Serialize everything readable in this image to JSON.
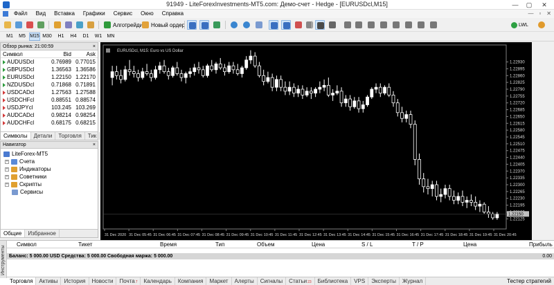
{
  "window": {
    "title": "91949 - LiteForexInvestments-MT5.com: Демо-счет - Hedge - [EURUSDcl,M15]",
    "minimize": "—",
    "maximize": "▢",
    "close": "✕"
  },
  "menu": {
    "items": [
      "Файл",
      "Вид",
      "Вставка",
      "Графики",
      "Сервис",
      "Окно",
      "Справка"
    ],
    "mdi_buttons": [
      "—",
      "▫",
      "✕"
    ]
  },
  "toolbar": {
    "algotrading_label": "Алготрейдинг",
    "new_order_label": "Новый ордер",
    "server_label": "LWL"
  },
  "timeframes": {
    "items": [
      "M1",
      "M5",
      "M15",
      "M30",
      "H1",
      "H4",
      "D1",
      "W1",
      "MN"
    ],
    "active": "M15"
  },
  "market_watch": {
    "title": "Обзор рынка: 21:00:59",
    "close": "×",
    "columns": {
      "symbol": "Символ",
      "bid": "Bid",
      "ask": "Ask"
    },
    "rows": [
      {
        "symbol": "AUDUSDcl",
        "bid": "0.76989",
        "ask": "0.77015",
        "dir": "up"
      },
      {
        "symbol": "GBPUSDcl",
        "bid": "1.36563",
        "ask": "1.36586",
        "dir": "up"
      },
      {
        "symbol": "EURUSDcl",
        "bid": "1.22150",
        "ask": "1.22170",
        "dir": "up"
      },
      {
        "symbol": "NZDUSDcl",
        "bid": "0.71868",
        "ask": "0.71891",
        "dir": "up"
      },
      {
        "symbol": "USDCADcl",
        "bid": "1.27563",
        "ask": "1.27588",
        "dir": "dn"
      },
      {
        "symbol": "USDCHFcl",
        "bid": "0.88551",
        "ask": "0.88574",
        "dir": "dn"
      },
      {
        "symbol": "USDJPYcl",
        "bid": "103.245",
        "ask": "103.269",
        "dir": "dn"
      },
      {
        "symbol": "AUDCADcl",
        "bid": "0.98214",
        "ask": "0.98254",
        "dir": "dn"
      },
      {
        "symbol": "AUDCHFcl",
        "bid": "0.68175",
        "ask": "0.68215",
        "dir": "dn"
      }
    ],
    "tabs": [
      "Символы",
      "Детали",
      "Торговля",
      "Тик"
    ]
  },
  "navigator": {
    "title": "Навигатор",
    "close": "×",
    "root": "LiteForex-MT5",
    "items": [
      "Счета",
      "Индикаторы",
      "Советники",
      "Скрипты",
      "Сервисы"
    ],
    "tabs": [
      "Общие",
      "Избранное"
    ]
  },
  "chart": {
    "label": "EURUSDcl, M15:  Euro vs US Dollar",
    "current_price": "1.22150",
    "colors": {
      "background": "#000000",
      "candle": "#ffffff",
      "up_body": "#ffffff",
      "down_body": "#000000",
      "axis_text": "#dcdcdc",
      "price_tag": "#c0c0c0"
    }
  },
  "chart_data": {
    "type": "candlestick",
    "symbol": "EURUSDcl",
    "timeframe": "M15",
    "title": "EURUSDcl, M15:  Euro vs US Dollar",
    "ylim": [
      1.2208,
      1.2301
    ],
    "y_ticks": [
      "1.22930",
      "1.22895",
      "1.22860",
      "1.22825",
      "1.22790",
      "1.22755",
      "1.22720",
      "1.22685",
      "1.22650",
      "1.22615",
      "1.22580",
      "1.22545",
      "1.22510",
      "1.22475",
      "1.22440",
      "1.22405",
      "1.22370",
      "1.22335",
      "1.22300",
      "1.22265",
      "1.22230",
      "1.22195",
      "1.22160",
      "1.22125"
    ],
    "x_ticks": [
      "31 Dec 2020",
      "31 Dec 05:45",
      "31 Dec 06:45",
      "31 Dec 07:45",
      "31 Dec 08:45",
      "31 Dec 09:45",
      "31 Dec 10:45",
      "31 Dec 11:45",
      "31 Dec 12:45",
      "31 Dec 13:45",
      "31 Dec 14:45",
      "31 Dec 15:45",
      "31 Dec 16:45",
      "31 Dec 17:45",
      "31 Dec 18:45",
      "31 Dec 19:45",
      "31 Dec 20:45"
    ],
    "last_price": 1.2215,
    "candles": [
      {
        "o": 1.2285,
        "h": 1.2291,
        "l": 1.2281,
        "c": 1.2288
      },
      {
        "o": 1.2288,
        "h": 1.2291,
        "l": 1.2284,
        "c": 1.2286
      },
      {
        "o": 1.2286,
        "h": 1.2289,
        "l": 1.2282,
        "c": 1.2284
      },
      {
        "o": 1.2284,
        "h": 1.2291,
        "l": 1.2283,
        "c": 1.2289
      },
      {
        "o": 1.2289,
        "h": 1.2294,
        "l": 1.2286,
        "c": 1.2288
      },
      {
        "o": 1.2288,
        "h": 1.2291,
        "l": 1.2285,
        "c": 1.2287
      },
      {
        "o": 1.2287,
        "h": 1.2289,
        "l": 1.2283,
        "c": 1.2285
      },
      {
        "o": 1.2285,
        "h": 1.229,
        "l": 1.2284,
        "c": 1.2288
      },
      {
        "o": 1.2288,
        "h": 1.2292,
        "l": 1.2286,
        "c": 1.2287
      },
      {
        "o": 1.2287,
        "h": 1.2289,
        "l": 1.2283,
        "c": 1.2285
      },
      {
        "o": 1.2285,
        "h": 1.2291,
        "l": 1.2284,
        "c": 1.2289
      },
      {
        "o": 1.2289,
        "h": 1.2293,
        "l": 1.2287,
        "c": 1.2291
      },
      {
        "o": 1.2291,
        "h": 1.2294,
        "l": 1.2287,
        "c": 1.2288
      },
      {
        "o": 1.2288,
        "h": 1.229,
        "l": 1.2284,
        "c": 1.2286
      },
      {
        "o": 1.2286,
        "h": 1.2291,
        "l": 1.2285,
        "c": 1.229
      },
      {
        "o": 1.229,
        "h": 1.2293,
        "l": 1.2286,
        "c": 1.2287
      },
      {
        "o": 1.2287,
        "h": 1.2289,
        "l": 1.2283,
        "c": 1.2285
      },
      {
        "o": 1.2285,
        "h": 1.2288,
        "l": 1.2282,
        "c": 1.2287
      },
      {
        "o": 1.2287,
        "h": 1.229,
        "l": 1.2285,
        "c": 1.2288
      },
      {
        "o": 1.2288,
        "h": 1.2292,
        "l": 1.2286,
        "c": 1.229
      },
      {
        "o": 1.229,
        "h": 1.2293,
        "l": 1.2287,
        "c": 1.2289
      },
      {
        "o": 1.2289,
        "h": 1.2291,
        "l": 1.2285,
        "c": 1.2286
      },
      {
        "o": 1.2286,
        "h": 1.2292,
        "l": 1.2285,
        "c": 1.2291
      },
      {
        "o": 1.2291,
        "h": 1.2294,
        "l": 1.2288,
        "c": 1.2289
      },
      {
        "o": 1.2289,
        "h": 1.2293,
        "l": 1.2287,
        "c": 1.2292
      },
      {
        "o": 1.2292,
        "h": 1.2295,
        "l": 1.2289,
        "c": 1.229
      },
      {
        "o": 1.229,
        "h": 1.2292,
        "l": 1.2286,
        "c": 1.2288
      },
      {
        "o": 1.2288,
        "h": 1.2293,
        "l": 1.2287,
        "c": 1.2291
      },
      {
        "o": 1.2291,
        "h": 1.2293,
        "l": 1.2287,
        "c": 1.2289
      },
      {
        "o": 1.2289,
        "h": 1.2292,
        "l": 1.2286,
        "c": 1.2287
      },
      {
        "o": 1.2287,
        "h": 1.2291,
        "l": 1.2285,
        "c": 1.229
      },
      {
        "o": 1.229,
        "h": 1.2296,
        "l": 1.2289,
        "c": 1.2294
      },
      {
        "o": 1.2294,
        "h": 1.2299,
        "l": 1.2292,
        "c": 1.2296
      },
      {
        "o": 1.2296,
        "h": 1.2298,
        "l": 1.229,
        "c": 1.2291
      },
      {
        "o": 1.2291,
        "h": 1.2293,
        "l": 1.2285,
        "c": 1.2286
      },
      {
        "o": 1.2286,
        "h": 1.2289,
        "l": 1.2281,
        "c": 1.2283
      },
      {
        "o": 1.2283,
        "h": 1.2288,
        "l": 1.2282,
        "c": 1.2285
      },
      {
        "o": 1.2285,
        "h": 1.2287,
        "l": 1.2278,
        "c": 1.228
      },
      {
        "o": 1.228,
        "h": 1.2286,
        "l": 1.2278,
        "c": 1.2284
      },
      {
        "o": 1.2284,
        "h": 1.2286,
        "l": 1.2278,
        "c": 1.228
      },
      {
        "o": 1.228,
        "h": 1.2283,
        "l": 1.2276,
        "c": 1.2278
      },
      {
        "o": 1.2278,
        "h": 1.2283,
        "l": 1.2276,
        "c": 1.228
      },
      {
        "o": 1.228,
        "h": 1.2282,
        "l": 1.2275,
        "c": 1.2277
      },
      {
        "o": 1.2277,
        "h": 1.2281,
        "l": 1.2275,
        "c": 1.2279
      },
      {
        "o": 1.2279,
        "h": 1.2281,
        "l": 1.2274,
        "c": 1.2276
      },
      {
        "o": 1.2276,
        "h": 1.228,
        "l": 1.2275,
        "c": 1.2278
      },
      {
        "o": 1.2278,
        "h": 1.228,
        "l": 1.2274,
        "c": 1.2277
      },
      {
        "o": 1.2277,
        "h": 1.228,
        "l": 1.2275,
        "c": 1.2279
      },
      {
        "o": 1.2279,
        "h": 1.2283,
        "l": 1.2277,
        "c": 1.228
      },
      {
        "o": 1.228,
        "h": 1.2284,
        "l": 1.2278,
        "c": 1.2281
      },
      {
        "o": 1.2281,
        "h": 1.2285,
        "l": 1.2275,
        "c": 1.2276
      },
      {
        "o": 1.2276,
        "h": 1.2279,
        "l": 1.2273,
        "c": 1.2277
      },
      {
        "o": 1.2277,
        "h": 1.2281,
        "l": 1.2276,
        "c": 1.2278
      },
      {
        "o": 1.2278,
        "h": 1.228,
        "l": 1.227,
        "c": 1.2272
      },
      {
        "o": 1.2272,
        "h": 1.2276,
        "l": 1.227,
        "c": 1.2274
      },
      {
        "o": 1.2274,
        "h": 1.2276,
        "l": 1.2268,
        "c": 1.227
      },
      {
        "o": 1.227,
        "h": 1.2275,
        "l": 1.2269,
        "c": 1.2273
      },
      {
        "o": 1.2273,
        "h": 1.2275,
        "l": 1.2267,
        "c": 1.2269
      },
      {
        "o": 1.2269,
        "h": 1.2273,
        "l": 1.2267,
        "c": 1.2271
      },
      {
        "o": 1.2271,
        "h": 1.2276,
        "l": 1.227,
        "c": 1.2275
      },
      {
        "o": 1.2275,
        "h": 1.228,
        "l": 1.2274,
        "c": 1.2279
      },
      {
        "o": 1.2279,
        "h": 1.2282,
        "l": 1.2277,
        "c": 1.228
      },
      {
        "o": 1.228,
        "h": 1.2282,
        "l": 1.2275,
        "c": 1.2277
      },
      {
        "o": 1.2277,
        "h": 1.2281,
        "l": 1.2276,
        "c": 1.228
      },
      {
        "o": 1.228,
        "h": 1.2282,
        "l": 1.2275,
        "c": 1.2276
      },
      {
        "o": 1.2276,
        "h": 1.2278,
        "l": 1.227,
        "c": 1.2272
      },
      {
        "o": 1.2272,
        "h": 1.2274,
        "l": 1.2265,
        "c": 1.2267
      },
      {
        "o": 1.2267,
        "h": 1.227,
        "l": 1.2262,
        "c": 1.2264
      },
      {
        "o": 1.2264,
        "h": 1.2268,
        "l": 1.2262,
        "c": 1.2266
      },
      {
        "o": 1.2266,
        "h": 1.2268,
        "l": 1.2259,
        "c": 1.2261
      },
      {
        "o": 1.2261,
        "h": 1.2263,
        "l": 1.224,
        "c": 1.2243
      },
      {
        "o": 1.2243,
        "h": 1.2246,
        "l": 1.223,
        "c": 1.2233
      },
      {
        "o": 1.2233,
        "h": 1.2236,
        "l": 1.2226,
        "c": 1.2229
      },
      {
        "o": 1.2229,
        "h": 1.2233,
        "l": 1.2225,
        "c": 1.2228
      },
      {
        "o": 1.2228,
        "h": 1.2232,
        "l": 1.2224,
        "c": 1.223
      },
      {
        "o": 1.223,
        "h": 1.2232,
        "l": 1.2222,
        "c": 1.2224
      },
      {
        "o": 1.2224,
        "h": 1.2228,
        "l": 1.2221,
        "c": 1.2225
      },
      {
        "o": 1.2225,
        "h": 1.223,
        "l": 1.2223,
        "c": 1.2228
      },
      {
        "o": 1.2228,
        "h": 1.223,
        "l": 1.2222,
        "c": 1.2224
      },
      {
        "o": 1.2224,
        "h": 1.2227,
        "l": 1.222,
        "c": 1.2222
      },
      {
        "o": 1.2222,
        "h": 1.2226,
        "l": 1.222,
        "c": 1.2224
      },
      {
        "o": 1.2224,
        "h": 1.2227,
        "l": 1.2219,
        "c": 1.2221
      },
      {
        "o": 1.2221,
        "h": 1.2224,
        "l": 1.2218,
        "c": 1.2222
      },
      {
        "o": 1.2222,
        "h": 1.2225,
        "l": 1.2219,
        "c": 1.2221
      },
      {
        "o": 1.2221,
        "h": 1.2224,
        "l": 1.2217,
        "c": 1.2219
      },
      {
        "o": 1.2219,
        "h": 1.2222,
        "l": 1.2216,
        "c": 1.222
      },
      {
        "o": 1.222,
        "h": 1.2221,
        "l": 1.2215,
        "c": 1.2216
      },
      {
        "o": 1.2216,
        "h": 1.2219,
        "l": 1.2213,
        "c": 1.2215
      },
      {
        "o": 1.2215,
        "h": 1.2216,
        "l": 1.2212,
        "c": 1.2213
      },
      {
        "o": 1.2213,
        "h": 1.2216,
        "l": 1.2212,
        "c": 1.2215
      }
    ]
  },
  "toolbox": {
    "side_title": "Инструменты",
    "columns": [
      "Символ",
      "Тикет",
      "Время",
      "Тип",
      "Объем",
      "Цена",
      "S / L",
      "T / P",
      "Цена",
      "Прибыль"
    ],
    "balance_text": "Баланс: 5 000.00 USD  Средства: 5 000.00  Свободная маржа: 5 000.00",
    "balance_value": "0.00",
    "tabs": [
      {
        "label": "Торговля",
        "badge": ""
      },
      {
        "label": "Активы",
        "badge": ""
      },
      {
        "label": "История",
        "badge": ""
      },
      {
        "label": "Новости",
        "badge": ""
      },
      {
        "label": "Почта",
        "badge": "7"
      },
      {
        "label": "Календарь",
        "badge": ""
      },
      {
        "label": "Компания",
        "badge": ""
      },
      {
        "label": "Маркет",
        "badge": ""
      },
      {
        "label": "Алерты",
        "badge": ""
      },
      {
        "label": "Сигналы",
        "badge": ""
      },
      {
        "label": "Статьи",
        "badge": "23"
      },
      {
        "label": "Библиотека",
        "badge": ""
      },
      {
        "label": "VPS",
        "badge": ""
      },
      {
        "label": "Эксперты",
        "badge": ""
      },
      {
        "label": "Журнал",
        "badge": ""
      }
    ],
    "strategy_tester": "Тестер стратегий"
  }
}
